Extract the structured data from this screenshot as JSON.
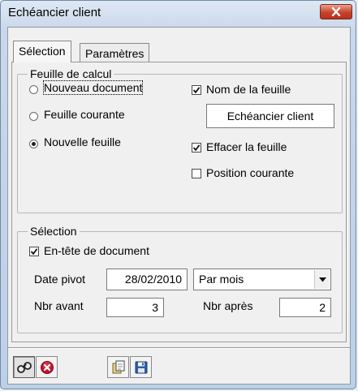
{
  "window": {
    "title": "Echéancier client"
  },
  "tabs": [
    {
      "label": "Sélection"
    },
    {
      "label": "Paramètres"
    }
  ],
  "feuille": {
    "group_label": "Feuille de calcul",
    "radio_nouveau_document": "Nouveau document",
    "radio_feuille_courante": "Feuille courante",
    "radio_nouvelle_feuille": "Nouvelle feuille",
    "selected_radio": "Nouvelle feuille",
    "check_nom_feuille": "Nom de la feuille",
    "nom_feuille_value": "Echéancier client",
    "check_effacer": "Effacer la feuille",
    "check_position": "Position courante",
    "nom_feuille_checked": true,
    "effacer_checked": true,
    "position_checked": false
  },
  "selection": {
    "group_label": "Sélection",
    "check_entete": "En-tête de document",
    "entete_checked": true,
    "date_pivot_label": "Date pivot",
    "date_pivot_value": "28/02/2010",
    "period_value": "Par mois",
    "nbr_avant_label": "Nbr avant",
    "nbr_avant_value": "3",
    "nbr_apres_label": "Nbr après",
    "nbr_apres_value": "2"
  },
  "toolbar": {
    "icons": [
      "binoculars-icon",
      "cancel-icon",
      "copy-icon",
      "save-icon"
    ]
  },
  "colors": {
    "close_button": "#c7432a",
    "cancel_icon": "#c8102e"
  }
}
